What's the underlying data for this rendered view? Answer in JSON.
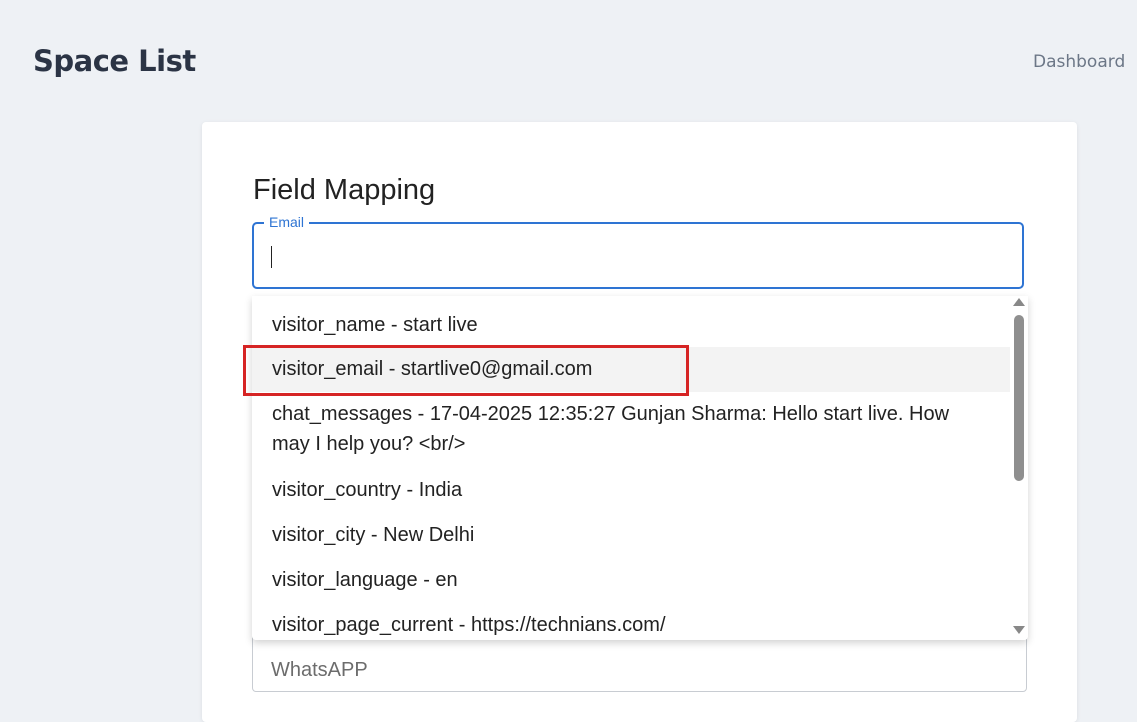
{
  "header": {
    "title": "Space List",
    "breadcrumb": "Dashboard"
  },
  "form": {
    "title": "Field Mapping",
    "email_field": {
      "label": "Email",
      "value": ""
    },
    "next_field": {
      "value": "WhatsAPP"
    }
  },
  "dropdown": {
    "options": [
      "visitor_name - start live",
      "visitor_email - startlive0@gmail.com",
      "chat_messages - 17-04-2025 12:35:27 Gunjan Sharma: Hello start live. How may I help you? <br/>",
      "visitor_country - India",
      "visitor_city - New Delhi",
      "visitor_language - en",
      "visitor_page_current - https://technians.com/"
    ],
    "highlighted_index": 1
  },
  "colors": {
    "focus_border": "#2e74d3",
    "highlight_box": "#d62424",
    "background": "#eef1f5"
  }
}
